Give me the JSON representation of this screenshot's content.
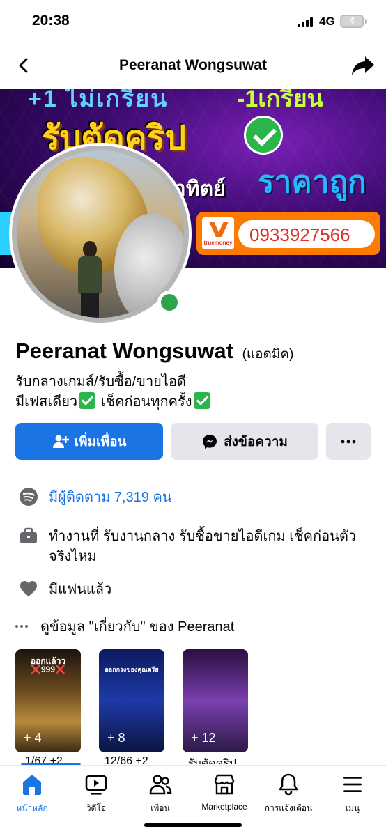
{
  "status_bar": {
    "time": "20:38",
    "network": "4G",
    "battery": "4"
  },
  "nav": {
    "title": "Peeranat Wongsuwat"
  },
  "cover": {
    "top_text_left": "+1 ไม่เกรียน",
    "top_text_right": "-1เกรียน",
    "headline": "รับตัดคริป",
    "subline": "าทิตย์",
    "price_text": "ราคาถูก",
    "phone": "0933927566",
    "payment_brand": "truemoney"
  },
  "profile": {
    "name": "Peeranat Wongsuwat",
    "alt_name": "(แอดมิค)",
    "bio_line1": "รับกลางเกมส์/รับซื้อ/ขายไอดี",
    "bio_line2_a": "มีเฟสเดียว",
    "bio_line2_b": " เช็คก่อนทุกครั้ง",
    "online": true
  },
  "actions": {
    "add_friend": "เพิ่มเพื่อน",
    "message": "ส่งข้อความ"
  },
  "details": {
    "followers": "มีผู้ติดตาม 7,319 คน",
    "work": "ทำงานที่ รับงานกลาง รับซื้อขายไอดีเกม เช็คก่อนตัวจริงไหม",
    "relationship": "มีแฟนแล้ว",
    "about_link": "ดูข้อมูล \"เกี่ยวกับ\" ของ Peeranat"
  },
  "reels": [
    {
      "caption": "ออกแล้วว",
      "caption2": "❌999❌",
      "count": "+ 4",
      "label": "1/67 +2"
    },
    {
      "caption": "ออกกรงของคุณตรีย",
      "caption2": "",
      "count": "+ 8",
      "label": "12/66 +2"
    },
    {
      "caption": "",
      "caption2": "",
      "count": "+ 12",
      "label": "รับตัดคริป"
    }
  ],
  "tabs": [
    {
      "label": "หน้าหลัก",
      "icon": "home-icon",
      "active": true
    },
    {
      "label": "วิดีโอ",
      "icon": "video-icon",
      "active": false
    },
    {
      "label": "เพื่อน",
      "icon": "friends-icon",
      "active": false
    },
    {
      "label": "Marketplace",
      "icon": "marketplace-icon",
      "active": false
    },
    {
      "label": "การแจ้งเตือน",
      "icon": "bell-icon",
      "active": false
    },
    {
      "label": "เมนู",
      "icon": "menu-icon",
      "active": false
    }
  ],
  "colors": {
    "accent": "#1b74e4",
    "online": "#31a24c",
    "button_secondary": "#e4e6eb"
  }
}
